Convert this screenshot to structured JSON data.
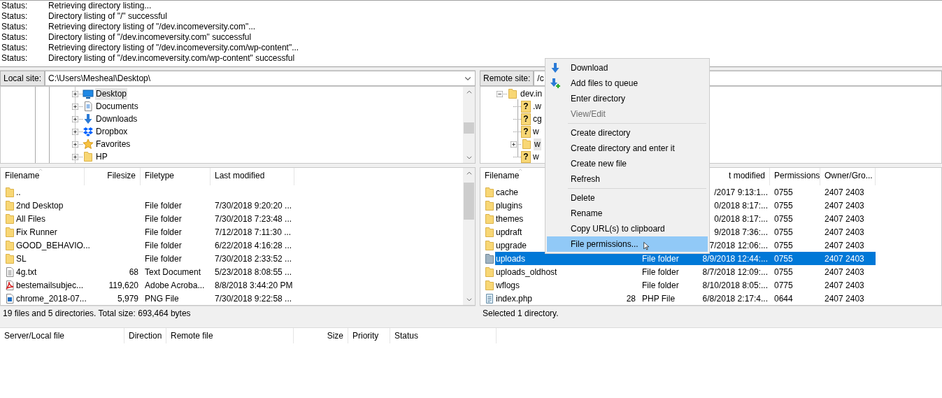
{
  "log": [
    {
      "label": "Status:",
      "message": "Retrieving directory listing..."
    },
    {
      "label": "Status:",
      "message": "Directory listing of \"/\" successful"
    },
    {
      "label": "Status:",
      "message": "Retrieving directory listing of \"/dev.incomeversity.com\"..."
    },
    {
      "label": "Status:",
      "message": "Directory listing of \"/dev.incomeversity.com\" successful"
    },
    {
      "label": "Status:",
      "message": "Retrieving directory listing of \"/dev.incomeversity.com/wp-content\"..."
    },
    {
      "label": "Status:",
      "message": "Directory listing of \"/dev.incomeversity.com/wp-content\" successful"
    }
  ],
  "local": {
    "label": "Local site:",
    "path": "C:\\Users\\Mesheal\\Desktop\\",
    "tree": [
      {
        "name": "Desktop",
        "kind": "desktop",
        "expanded": false,
        "selected": true
      },
      {
        "name": "Documents",
        "kind": "document",
        "expanded": false,
        "selected": false
      },
      {
        "name": "Downloads",
        "kind": "download",
        "expanded": false,
        "selected": false
      },
      {
        "name": "Dropbox",
        "kind": "dropbox",
        "expanded": false,
        "selected": false
      },
      {
        "name": "Favorites",
        "kind": "star",
        "expanded": false,
        "selected": false
      },
      {
        "name": "HP",
        "kind": "folder",
        "expanded": false,
        "selected": false
      }
    ],
    "columns": [
      "Filename",
      "Filesize",
      "Filetype",
      "Last modified"
    ],
    "rows": [
      {
        "kind": "folder",
        "name": "..",
        "selected": false
      },
      {
        "kind": "folder",
        "name": "2nd Desktop",
        "type": "File folder",
        "modified": "7/30/2018 9:20:20 ...",
        "selected": false
      },
      {
        "kind": "folder",
        "name": "All Files",
        "type": "File folder",
        "modified": "7/30/2018 7:23:48 ...",
        "selected": false
      },
      {
        "kind": "folder",
        "name": "Fix Runner",
        "type": "File folder",
        "modified": "7/12/2018 7:11:30 ...",
        "selected": false
      },
      {
        "kind": "folder",
        "name": "GOOD_BEHAVIO...",
        "type": "File folder",
        "modified": "6/22/2018 4:16:28 ...",
        "selected": false
      },
      {
        "kind": "folder",
        "name": "SL",
        "type": "File folder",
        "modified": "7/30/2018 2:33:52 ...",
        "selected": false
      },
      {
        "kind": "text",
        "name": "4g.txt",
        "size": "68",
        "type": "Text Document",
        "modified": "5/23/2018 8:08:55 ...",
        "selected": false
      },
      {
        "kind": "pdf",
        "name": "bestemailsubjec...",
        "size": "119,620",
        "type": "Adobe Acroba...",
        "modified": "8/8/2018 3:44:20 PM",
        "selected": false
      },
      {
        "kind": "image",
        "name": "chrome_2018-07...",
        "size": "5,979",
        "type": "PNG File",
        "modified": "7/30/2018 9:22:58 ...",
        "selected": false
      }
    ],
    "status": "19 files and 5 directories. Total size: 693,464 bytes"
  },
  "remote": {
    "label": "Remote site:",
    "path": "/c",
    "tree": [
      {
        "name": "dev.in",
        "kind": "folder",
        "expanded": true,
        "selected": false,
        "children": [
          {
            "name": ".w",
            "kind": "unknown",
            "mark": "?",
            "selected": false
          },
          {
            "name": "cg",
            "kind": "unknown",
            "mark": "?",
            "selected": false
          },
          {
            "name": "w",
            "kind": "unknown",
            "mark": "?",
            "selected": false
          },
          {
            "name": "w",
            "kind": "folder",
            "expanded": false,
            "selected": true
          },
          {
            "name": "w",
            "kind": "unknown",
            "mark": "?",
            "selected": false
          }
        ]
      }
    ],
    "columns": [
      "Filename",
      null,
      null,
      "t modified",
      "Permissions",
      "Owner/Gro..."
    ],
    "rows": [
      {
        "kind": "folder",
        "name": "cache",
        "modified": "/2017 9:13:1...",
        "permissions": "0755",
        "owner": "2407 2403",
        "selected": false
      },
      {
        "kind": "folder",
        "name": "plugins",
        "modified": "0/2018 8:17:...",
        "permissions": "0755",
        "owner": "2407 2403",
        "selected": false
      },
      {
        "kind": "folder",
        "name": "themes",
        "modified": "0/2018 8:17:...",
        "permissions": "0755",
        "owner": "2407 2403",
        "selected": false
      },
      {
        "kind": "folder",
        "name": "updraft",
        "modified": "9/2018 7:36:...",
        "permissions": "0755",
        "owner": "2407 2403",
        "selected": false
      },
      {
        "kind": "folder",
        "name": "upgrade",
        "modified": "7/2018 12:06:...",
        "permissions": "0755",
        "owner": "2407 2403",
        "selected": false
      },
      {
        "kind": "folder",
        "name": "uploads",
        "type": "File folder",
        "modified": "8/9/2018 12:44:...",
        "permissions": "0755",
        "owner": "2407 2403",
        "selected": true
      },
      {
        "kind": "folder",
        "name": "uploads_oldhost",
        "type": "File folder",
        "modified": "8/7/2018 12:09:...",
        "permissions": "0755",
        "owner": "2407 2403",
        "selected": false
      },
      {
        "kind": "folder",
        "name": "wflogs",
        "type": "File folder",
        "modified": "8/10/2018 8:05:...",
        "permissions": "0775",
        "owner": "2407 2403",
        "selected": false
      },
      {
        "kind": "php",
        "name": "index.php",
        "size": "28",
        "type": "PHP File",
        "modified": "6/8/2018 2:17:4...",
        "permissions": "0644",
        "owner": "2407 2403",
        "selected": false
      }
    ],
    "status": "Selected 1 directory."
  },
  "context_menu": [
    {
      "kind": "download",
      "label": "Download",
      "disabled": false,
      "selected": false
    },
    {
      "kind": "queue",
      "label": "Add files to queue",
      "disabled": false,
      "selected": false
    },
    {
      "kind": "item",
      "label": "Enter directory",
      "disabled": false,
      "selected": false
    },
    {
      "kind": "item",
      "label": "View/Edit",
      "disabled": true,
      "selected": false
    },
    {
      "kind": "separator"
    },
    {
      "kind": "item",
      "label": "Create directory",
      "disabled": false,
      "selected": false
    },
    {
      "kind": "item",
      "label": "Create directory and enter it",
      "disabled": false,
      "selected": false
    },
    {
      "kind": "item",
      "label": "Create new file",
      "disabled": false,
      "selected": false
    },
    {
      "kind": "item",
      "label": "Refresh",
      "disabled": false,
      "selected": false
    },
    {
      "kind": "separator"
    },
    {
      "kind": "item",
      "label": "Delete",
      "disabled": false,
      "selected": false
    },
    {
      "kind": "item",
      "label": "Rename",
      "disabled": false,
      "selected": false
    },
    {
      "kind": "item",
      "label": "Copy URL(s) to clipboard",
      "disabled": false,
      "selected": false
    },
    {
      "kind": "item",
      "label": "File permissions...",
      "disabled": false,
      "selected": true
    }
  ],
  "queue": {
    "columns": [
      "Server/Local file",
      "Direction",
      "Remote file",
      "Size",
      "Priority",
      "Status"
    ]
  }
}
